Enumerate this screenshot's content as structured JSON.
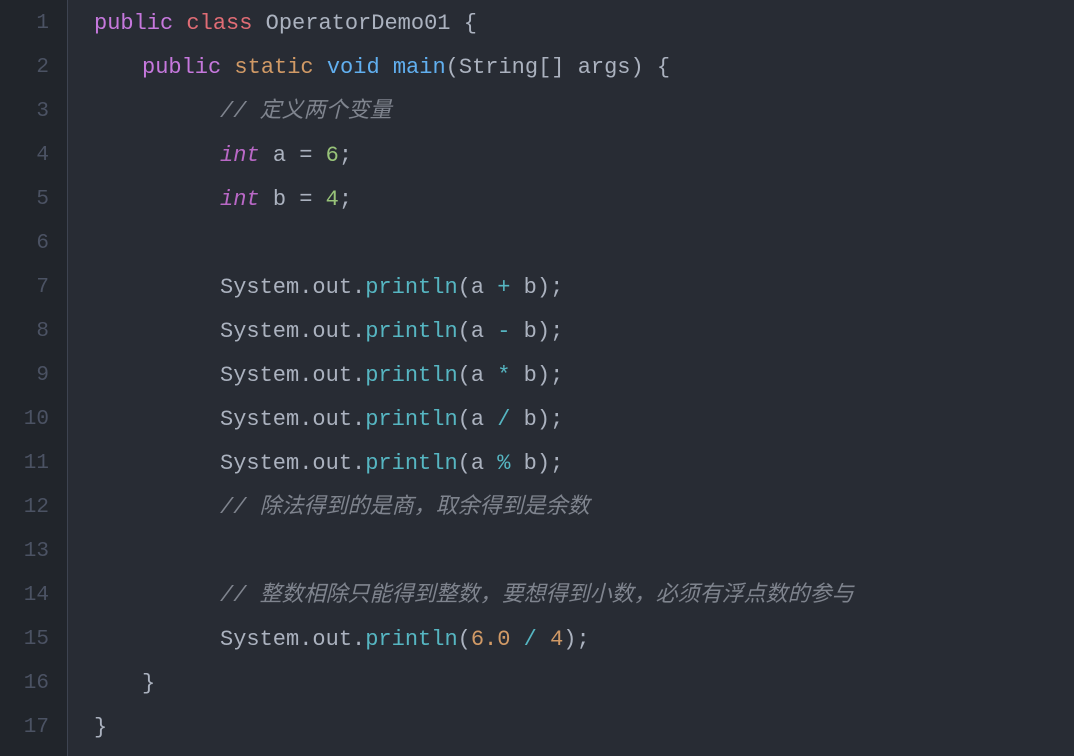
{
  "lines": [
    {
      "num": "1"
    },
    {
      "num": "2"
    },
    {
      "num": "3"
    },
    {
      "num": "4"
    },
    {
      "num": "5"
    },
    {
      "num": "6"
    },
    {
      "num": "7"
    },
    {
      "num": "8"
    },
    {
      "num": "9"
    },
    {
      "num": "10"
    },
    {
      "num": "11"
    },
    {
      "num": "12"
    },
    {
      "num": "13"
    },
    {
      "num": "14"
    },
    {
      "num": "15"
    },
    {
      "num": "16"
    },
    {
      "num": "17"
    }
  ],
  "code": {
    "kw_public": "public",
    "kw_class": "class",
    "kw_static": "static",
    "kw_void": "void",
    "kw_int": "int",
    "class_name": "OperatorDemo01",
    "method_main": "main",
    "param_type": "String[]",
    "param_name": "args",
    "var_a": "a",
    "var_b": "b",
    "val_6": "6",
    "val_4": "4",
    "val_6_0": "6.0",
    "system": "System",
    "out": "out",
    "println": "println",
    "op_assign": "=",
    "op_plus": "+",
    "op_minus": "-",
    "op_mult": "*",
    "op_div": "/",
    "op_mod": "%",
    "brace_open": "{",
    "brace_close": "}",
    "paren_open": "(",
    "paren_close": ")",
    "semicolon": ";",
    "dot": ".",
    "comment1": "// 定义两个变量",
    "comment2": "// 除法得到的是商，取余得到是余数",
    "comment3": "// 整数相除只能得到整数，要想得到小数，必须有浮点数的参与",
    "sp": " "
  }
}
